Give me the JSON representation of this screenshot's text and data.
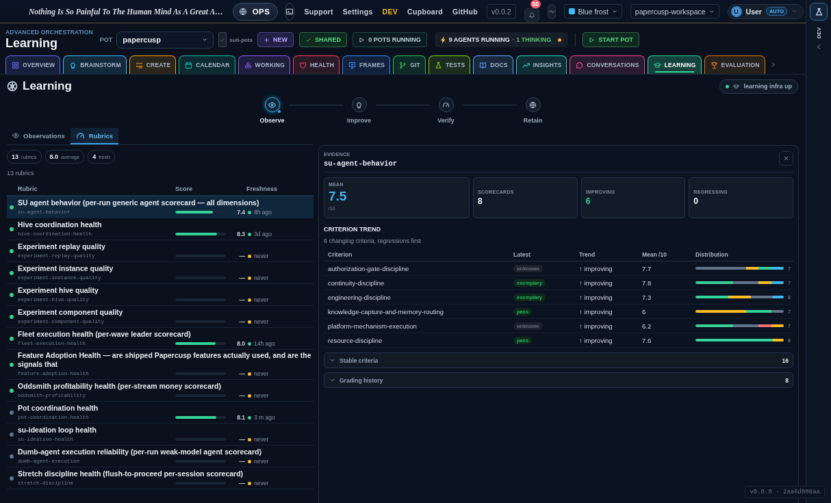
{
  "topbar": {
    "quote": "Nothing Is So Painful To The Human Mind As A Great A…",
    "mode": "OPS",
    "links": [
      {
        "label": "Support",
        "selected": false
      },
      {
        "label": "Settings",
        "selected": false
      },
      {
        "label": "DEV",
        "selected": true
      },
      {
        "label": "Cupboard",
        "selected": false
      },
      {
        "label": "GitHub",
        "selected": false
      }
    ],
    "version": "v0.0.2",
    "notifications": "50",
    "theme": {
      "label": "Blue frost",
      "color": "#38bdf8"
    },
    "workspace": "papercusp-workspace",
    "user": {
      "initial": "U",
      "name": "User",
      "badge": "AUTO"
    }
  },
  "rail": {
    "label": "DEV"
  },
  "header": {
    "eyebrow": "ADVANCED ORCHESTRATION",
    "title": "Learning",
    "pot_label": "POT",
    "pot": "papercusp",
    "subpots": {
      "label": "sub-pots",
      "checked": true
    },
    "actions": [
      {
        "kind": "new",
        "label": "NEW"
      },
      {
        "kind": "shared",
        "label": "SHARED"
      },
      {
        "kind": "running",
        "label": "0 POTS RUNNING"
      }
    ],
    "agents": {
      "running": "9 AGENTS RUNNING",
      "thinking": "· 1 THINKING"
    },
    "start": "START POT"
  },
  "tabs": [
    {
      "label": "OVERVIEW",
      "color": "#6366f1",
      "selected": false
    },
    {
      "label": "BRAINSTORM",
      "color": "#38bdf8",
      "selected": false
    },
    {
      "label": "CREATE",
      "color": "#f59e0b",
      "selected": false
    },
    {
      "label": "CALENDAR",
      "color": "#14b8a6",
      "selected": false
    },
    {
      "label": "WORKING",
      "color": "#8b5cf6",
      "selected": false
    },
    {
      "label": "HEALTH",
      "color": "#f43f5e",
      "selected": false
    },
    {
      "label": "FRAMES",
      "color": "#3b82f6",
      "selected": false
    },
    {
      "label": "GIT",
      "color": "#22c55e",
      "selected": false
    },
    {
      "label": "TESTS",
      "color": "#84cc16",
      "selected": false
    },
    {
      "label": "DOCS",
      "color": "#60a5fa",
      "selected": false
    },
    {
      "label": "INSIGHTS",
      "color": "#2dd4bf",
      "selected": false
    },
    {
      "label": "CONVERSATIONS",
      "color": "#ec4899",
      "selected": false
    },
    {
      "label": "LEARNING",
      "color": "#34d399",
      "selected": true
    },
    {
      "label": "EVALUATION",
      "color": "#d97706",
      "selected": false
    }
  ],
  "page": {
    "title": "Learning",
    "status": "learning infra up"
  },
  "steps": [
    {
      "label": "Observe",
      "selected": true
    },
    {
      "label": "Improve",
      "selected": false
    },
    {
      "label": "Verify",
      "selected": false
    },
    {
      "label": "Retain",
      "selected": false
    }
  ],
  "subtabs": [
    {
      "label": "Observations",
      "selected": false
    },
    {
      "label": "Rubrics",
      "selected": true
    }
  ],
  "chips": [
    {
      "value": "13",
      "label": "rubrics"
    },
    {
      "value": "8.0",
      "label": "average"
    },
    {
      "value": "4",
      "label": "fresh"
    }
  ],
  "count": "13 rubrics",
  "rubrics": {
    "columns": [
      "Rubric",
      "Score",
      "Freshness"
    ],
    "rows": [
      {
        "name": "SU agent behavior (per-run generic agent scorecard — all dimensions)",
        "slug": "su-agent-behavior",
        "color": "#34d399",
        "level": 0.74,
        "score": "7.4",
        "freshness": {
          "label": "8h ago",
          "color": "#34d399"
        },
        "selected": true
      },
      {
        "name": "Hive coordination health",
        "slug": "hive-coordination-health",
        "color": "#34d399",
        "level": 0.83,
        "score": "8.3",
        "freshness": {
          "label": "3d ago",
          "color": "#34d399"
        },
        "selected": false
      },
      {
        "name": "Experiment replay quality",
        "slug": "experiment-replay-quality",
        "color": "#34d399",
        "score": "—",
        "freshness": {
          "label": "never",
          "color": "#fbbf24"
        },
        "selected": false
      },
      {
        "name": "Experiment instance quality",
        "slug": "experiment-instance-quality",
        "color": "#34d399",
        "score": "—",
        "freshness": {
          "label": "never",
          "color": "#fbbf24"
        },
        "selected": false
      },
      {
        "name": "Experiment hive quality",
        "slug": "experiment-hive-quality",
        "color": "#34d399",
        "score": "—",
        "freshness": {
          "label": "never",
          "color": "#fbbf24"
        },
        "selected": false
      },
      {
        "name": "Experiment component quality",
        "slug": "experiment-component-quality",
        "color": "#34d399",
        "score": "—",
        "freshness": {
          "label": "never",
          "color": "#fbbf24"
        },
        "selected": false
      },
      {
        "name": "Fleet execution health (per-wave leader scorecard)",
        "slug": "fleet-execution-health",
        "color": "#34d399",
        "level": 0.8,
        "score": "8.0",
        "freshness": {
          "label": "14h ago",
          "color": "#34d399"
        },
        "selected": false
      },
      {
        "name": "Feature Adoption Health — are shipped Papercusp features actually used, and are the signals that",
        "slug": "feature-adoption-health",
        "color": "#34d399",
        "score": "—",
        "freshness": {
          "label": "never",
          "color": "#fbbf24"
        },
        "selected": false
      },
      {
        "name": "Oddsmith profitability health (per-stream money scorecard)",
        "slug": "oddsmith-profitability",
        "color": "#34d399",
        "score": "—",
        "freshness": {
          "label": "never",
          "color": "#fbbf24"
        },
        "selected": false
      },
      {
        "name": "Pot coordination health",
        "slug": "pot-coordination-health",
        "color": "#64748b",
        "level": 0.81,
        "score": "8.1",
        "freshness": {
          "label": "3 m ago",
          "color": "#34d399"
        },
        "selected": false
      },
      {
        "name": "su-ideation loop health",
        "slug": "su-ideation-health",
        "color": "#64748b",
        "score": "—",
        "freshness": {
          "label": "never",
          "color": "#fbbf24"
        },
        "selected": false
      },
      {
        "name": "Dumb-agent execution reliability (per-run weak-model agent scorecard)",
        "slug": "dumb-agent-execution",
        "color": "#64748b",
        "score": "—",
        "freshness": {
          "label": "never",
          "color": "#fbbf24"
        },
        "selected": false
      },
      {
        "name": "Stretch discipline health (flush-to-proceed per-session scorecard)",
        "slug": "stretch-discipline",
        "color": "#64748b",
        "score": "—",
        "freshness": {
          "label": "never",
          "color": "#fbbf24"
        },
        "selected": false
      }
    ]
  },
  "evidence": {
    "eyebrow": "EVIDENCE",
    "slug": "su-agent-behavior",
    "stats": [
      {
        "kind": "mean",
        "label": "MEAN",
        "value": "7.5",
        "unit": "/10"
      },
      {
        "kind": "plain",
        "label": "SCORECARDS",
        "value": "8"
      },
      {
        "kind": "good",
        "label": "IMPROVING",
        "value": "6"
      },
      {
        "kind": "plain",
        "label": "REGRESSING",
        "value": "0"
      }
    ],
    "section": "CRITERION TREND",
    "subtitle": "6 changing criteria, regressions first",
    "columns": [
      "Criterion",
      "Latest",
      "Trend",
      "Mean /10",
      "Distribution"
    ],
    "rows": [
      {
        "name": "authorization-gate-discipline",
        "latest": {
          "label": "unknown",
          "kind": "unknown"
        },
        "trend": "↑ improving",
        "mean": "7.7",
        "count": "7",
        "segments": [
          {
            "color": "#64748b"
          },
          {
            "color": "#64748b"
          },
          {
            "color": "#64748b"
          },
          {
            "color": "#64748b"
          },
          {
            "color": "#fbbf24"
          },
          {
            "color": "#34d399"
          },
          {
            "color": "#38bdf8"
          }
        ]
      },
      {
        "name": "continuity-discipline",
        "latest": {
          "label": "exemplary",
          "kind": "exemplary"
        },
        "trend": "↑ improving",
        "mean": "7.8",
        "count": "7",
        "segments": [
          {
            "color": "#34d399"
          },
          {
            "color": "#34d399"
          },
          {
            "color": "#34d399"
          },
          {
            "color": "#64748b"
          },
          {
            "color": "#64748b"
          },
          {
            "color": "#fbbf24"
          },
          {
            "color": "#38bdf8"
          }
        ]
      },
      {
        "name": "engineering-discipline",
        "latest": {
          "label": "exemplary",
          "kind": "exemplary"
        },
        "trend": "↑ improving",
        "mean": "7.3",
        "count": "8",
        "segments": [
          {
            "color": "#34d399"
          },
          {
            "color": "#34d399"
          },
          {
            "color": "#34d399"
          },
          {
            "color": "#fbbf24"
          },
          {
            "color": "#fbbf24"
          },
          {
            "color": "#64748b"
          },
          {
            "color": "#64748b"
          },
          {
            "color": "#38bdf8"
          }
        ]
      },
      {
        "name": "knowledge-capture-and-memory-routing",
        "latest": {
          "label": "pass",
          "kind": "pass"
        },
        "trend": "↑ improving",
        "mean": "6",
        "count": "7",
        "segments": [
          {
            "color": "#fbbf24"
          },
          {
            "color": "#fbbf24"
          },
          {
            "color": "#fbbf24"
          },
          {
            "color": "#fbbf24"
          },
          {
            "color": "#34d399"
          },
          {
            "color": "#34d399"
          },
          {
            "color": "#64748b"
          }
        ]
      },
      {
        "name": "platform-mechanism-execution",
        "latest": {
          "label": "unknown",
          "kind": "unknown"
        },
        "trend": "↑ improving",
        "mean": "6.2",
        "count": "7",
        "segments": [
          {
            "color": "#34d399"
          },
          {
            "color": "#34d399"
          },
          {
            "color": "#34d399"
          },
          {
            "color": "#64748b"
          },
          {
            "color": "#64748b"
          },
          {
            "color": "#f87171"
          },
          {
            "color": "#fbbf24"
          }
        ]
      },
      {
        "name": "resource-discipline",
        "latest": {
          "label": "pass",
          "kind": "pass"
        },
        "trend": "↑ improving",
        "mean": "7.6",
        "count": "8",
        "segments": [
          {
            "color": "#34d399"
          },
          {
            "color": "#34d399"
          },
          {
            "color": "#34d399"
          },
          {
            "color": "#34d399"
          },
          {
            "color": "#34d399"
          },
          {
            "color": "#34d399"
          },
          {
            "color": "#34d399"
          },
          {
            "color": "#fbbf24"
          }
        ]
      }
    ],
    "sections": [
      {
        "label": "Stable criteria",
        "count": "16",
        "expanded": false
      },
      {
        "label": "Grading history",
        "count": "8",
        "expanded": false
      }
    ]
  },
  "footer": "v0.0.0 · 2aa6d008aa"
}
